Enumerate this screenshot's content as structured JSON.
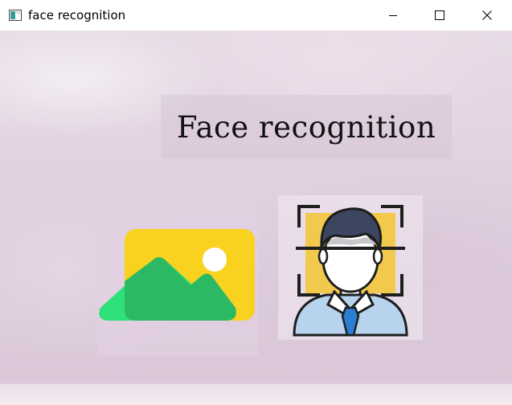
{
  "window": {
    "title": "face recognition",
    "app_icon": "window-app-icon",
    "controls": {
      "minimize_icon": "minimize-icon",
      "maximize_icon": "maximize-icon",
      "close_icon": "close-icon"
    }
  },
  "main": {
    "heading": "Face recognition",
    "buttons": [
      {
        "name": "image-select-button",
        "icon": "image-icon"
      },
      {
        "name": "face-recognition-button",
        "icon": "face-scan-icon"
      }
    ]
  },
  "colors": {
    "background": "#e2d3e1",
    "image_icon_yellow": "#f9d11f",
    "image_icon_green_light": "#2ee07a",
    "image_icon_green_dark": "#2bba63",
    "face_hair": "#3d4660",
    "face_scan_yellow": "#f2c94c",
    "face_shirt": "#b7d3ee",
    "face_tie": "#2a7fd3"
  }
}
